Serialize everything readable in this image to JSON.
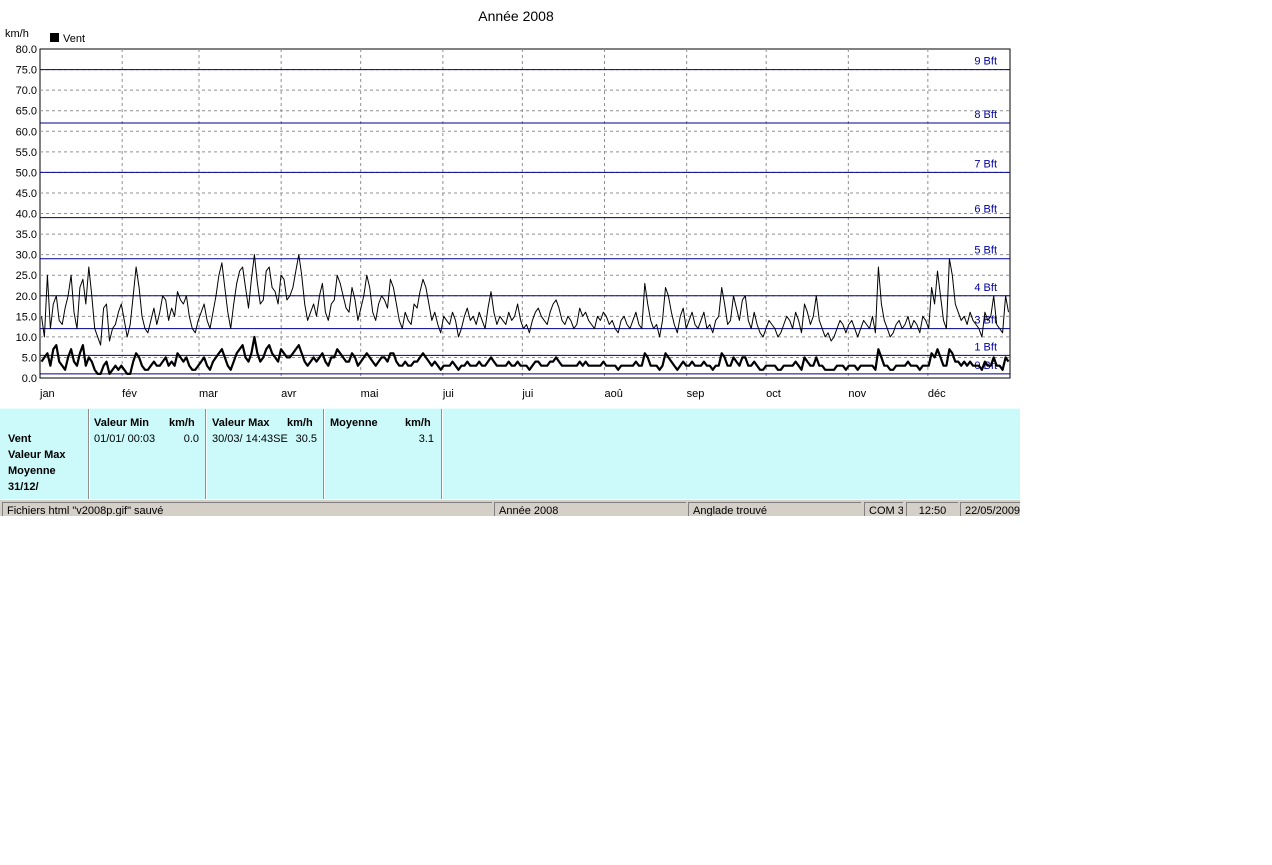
{
  "chart_data": {
    "type": "line",
    "title": "Année 2008",
    "ylabel": "km/h",
    "legend": {
      "position": "top-left",
      "label": "Vent"
    },
    "ylim": [
      0,
      80
    ],
    "yticks": [
      "0.0",
      "5.0",
      "10.0",
      "15.0",
      "20.0",
      "25.0",
      "30.0",
      "35.0",
      "40.0",
      "45.0",
      "50.0",
      "55.0",
      "60.0",
      "65.0",
      "70.0",
      "75.0",
      "80.0"
    ],
    "months": [
      "jan",
      "fév",
      "mar",
      "avr",
      "mai",
      "jui",
      "jui",
      "aoû",
      "sep",
      "oct",
      "nov",
      "déc"
    ],
    "month_days": [
      0,
      31,
      60,
      91,
      121,
      152,
      182,
      213,
      244,
      274,
      305,
      335
    ],
    "days_in_year": 366,
    "grid": true,
    "beaufort": [
      {
        "label": "0 Bft",
        "value": 1
      },
      {
        "label": "1 Bft",
        "value": 5.5
      },
      {
        "label": "3 Bft",
        "value": 12
      },
      {
        "label": "4 Bft",
        "value": 20
      },
      {
        "label": "5 Bft",
        "value": 29
      },
      {
        "label": "6 Bft",
        "value": 39
      },
      {
        "label": "7 Bft",
        "value": 50
      },
      {
        "label": "8 Bft",
        "value": 62
      },
      {
        "label": "9 Bft",
        "value": 75
      }
    ],
    "series": [
      {
        "name": "",
        "style": "thin",
        "values": [
          15,
          10,
          25,
          12,
          18,
          20,
          14,
          13,
          17,
          20,
          25,
          16,
          12,
          22,
          24,
          18,
          27,
          20,
          12,
          10,
          8,
          17,
          18,
          9,
          12,
          13,
          16,
          18,
          14,
          10,
          13,
          20,
          27,
          22,
          15,
          12,
          11,
          14,
          17,
          13,
          16,
          20,
          19,
          14,
          17,
          15,
          21,
          19,
          18,
          20,
          15,
          12,
          11,
          14,
          16,
          18,
          14,
          12,
          16,
          20,
          25,
          28,
          22,
          16,
          12,
          18,
          23,
          26,
          27,
          22,
          17,
          24,
          30,
          23,
          18,
          19,
          26,
          27,
          22,
          21,
          18,
          25,
          24,
          19,
          20,
          22,
          26,
          30,
          25,
          18,
          14,
          16,
          18,
          15,
          20,
          23,
          16,
          14,
          18,
          19,
          25,
          23,
          20,
          17,
          16,
          22,
          19,
          14,
          17,
          20,
          25,
          22,
          16,
          14,
          18,
          20,
          19,
          17,
          24,
          22,
          18,
          14,
          12,
          16,
          14,
          13,
          18,
          17,
          21,
          24,
          22,
          18,
          14,
          16,
          13,
          11,
          15,
          14,
          13,
          16,
          14,
          10,
          12,
          15,
          17,
          14,
          15,
          13,
          16,
          14,
          12,
          17,
          21,
          16,
          13,
          15,
          14,
          13,
          16,
          14,
          15,
          18,
          14,
          12,
          13,
          11,
          14,
          16,
          17,
          15,
          14,
          13,
          16,
          18,
          19,
          17,
          14,
          13,
          15,
          14,
          12,
          13,
          17,
          15,
          16,
          14,
          13,
          12,
          15,
          14,
          16,
          15,
          13,
          14,
          12,
          11,
          14,
          15,
          13,
          12,
          14,
          16,
          13,
          12,
          23,
          18,
          14,
          12,
          13,
          10,
          14,
          22,
          20,
          16,
          13,
          11,
          15,
          17,
          12,
          14,
          16,
          13,
          12,
          14,
          16,
          12,
          13,
          11,
          14,
          15,
          22,
          18,
          13,
          14,
          20,
          17,
          14,
          19,
          20,
          14,
          12,
          16,
          13,
          11,
          10,
          12,
          14,
          13,
          12,
          10,
          11,
          13,
          15,
          14,
          12,
          16,
          14,
          11,
          18,
          16,
          13,
          15,
          20,
          14,
          12,
          10,
          11,
          9,
          10,
          12,
          14,
          13,
          11,
          13,
          14,
          12,
          10,
          12,
          14,
          13,
          12,
          15,
          11,
          27,
          18,
          14,
          12,
          10,
          11,
          13,
          14,
          12,
          13,
          15,
          12,
          14,
          13,
          11,
          15,
          14,
          12,
          22,
          18,
          26,
          20,
          14,
          12,
          29,
          25,
          18,
          16,
          14,
          15,
          13,
          16,
          14,
          13,
          12,
          10,
          16,
          14,
          15,
          20,
          13,
          12,
          11,
          20,
          16
        ]
      },
      {
        "name": "",
        "style": "thick",
        "values": [
          4,
          5,
          6,
          3,
          7,
          8,
          4,
          3,
          2,
          5,
          7,
          4,
          3,
          6,
          8,
          3,
          5,
          4,
          2,
          1,
          1,
          3,
          4,
          1,
          2,
          3,
          2,
          3,
          2,
          1,
          1,
          4,
          6,
          5,
          3,
          2,
          2,
          3,
          4,
          3,
          3,
          4,
          5,
          3,
          4,
          3,
          6,
          5,
          4,
          5,
          3,
          2,
          2,
          3,
          4,
          5,
          3,
          2,
          4,
          5,
          6,
          7,
          5,
          3,
          2,
          4,
          6,
          7,
          8,
          5,
          4,
          6,
          10,
          6,
          4,
          5,
          7,
          8,
          6,
          5,
          4,
          7,
          6,
          5,
          5,
          6,
          7,
          8,
          6,
          4,
          3,
          4,
          5,
          4,
          5,
          6,
          4,
          3,
          5,
          5,
          7,
          6,
          5,
          4,
          4,
          6,
          5,
          3,
          4,
          5,
          6,
          5,
          4,
          3,
          4,
          5,
          5,
          4,
          6,
          6,
          4,
          3,
          3,
          4,
          3,
          3,
          4,
          4,
          5,
          6,
          5,
          4,
          3,
          4,
          3,
          2,
          3,
          3,
          3,
          4,
          3,
          2,
          3,
          3,
          4,
          3,
          3,
          3,
          4,
          3,
          3,
          4,
          5,
          4,
          3,
          3,
          3,
          3,
          4,
          3,
          3,
          4,
          3,
          3,
          3,
          2,
          3,
          4,
          4,
          3,
          3,
          3,
          4,
          4,
          5,
          4,
          3,
          3,
          3,
          3,
          3,
          3,
          4,
          3,
          4,
          3,
          3,
          3,
          3,
          3,
          4,
          3,
          3,
          3,
          3,
          2,
          3,
          3,
          3,
          3,
          3,
          4,
          3,
          3,
          6,
          5,
          3,
          3,
          3,
          2,
          3,
          6,
          5,
          4,
          3,
          2,
          3,
          4,
          3,
          3,
          4,
          3,
          3,
          3,
          4,
          3,
          3,
          2,
          3,
          3,
          6,
          5,
          3,
          3,
          5,
          4,
          3,
          5,
          5,
          3,
          3,
          4,
          3,
          2,
          2,
          3,
          3,
          3,
          3,
          2,
          2,
          3,
          3,
          3,
          3,
          4,
          3,
          2,
          5,
          4,
          3,
          3,
          5,
          3,
          3,
          2,
          2,
          2,
          2,
          3,
          3,
          3,
          2,
          3,
          3,
          3,
          2,
          3,
          3,
          3,
          3,
          3,
          2,
          7,
          5,
          3,
          3,
          2,
          2,
          3,
          3,
          3,
          3,
          4,
          3,
          3,
          3,
          2,
          3,
          3,
          3,
          6,
          5,
          7,
          5,
          3,
          3,
          7,
          6,
          4,
          4,
          3,
          4,
          3,
          4,
          3,
          3,
          3,
          2,
          4,
          3,
          3,
          5,
          3,
          3,
          2,
          5,
          4
        ]
      }
    ]
  },
  "stats": {
    "row_labels": [
      "Vent",
      "Valeur Max",
      "Moyenne",
      "31/12/"
    ],
    "min": {
      "header": "Valeur Min",
      "unit": "km/h",
      "date": "01/01/  00:03",
      "value": "0.0"
    },
    "max": {
      "header": "Valeur Max",
      "unit": "km/h",
      "date": "30/03/  14:43SE",
      "value": "30.5"
    },
    "avg": {
      "header": "Moyenne",
      "unit": "km/h",
      "value": "3.1"
    }
  },
  "statusbar": {
    "message": "Fichiers html  \"v2008p.gif\"  sauvé",
    "period": "Année 2008",
    "location": "Anglade trouvé",
    "port": "COM 3",
    "time": "12:50",
    "date": "22/05/2009"
  }
}
